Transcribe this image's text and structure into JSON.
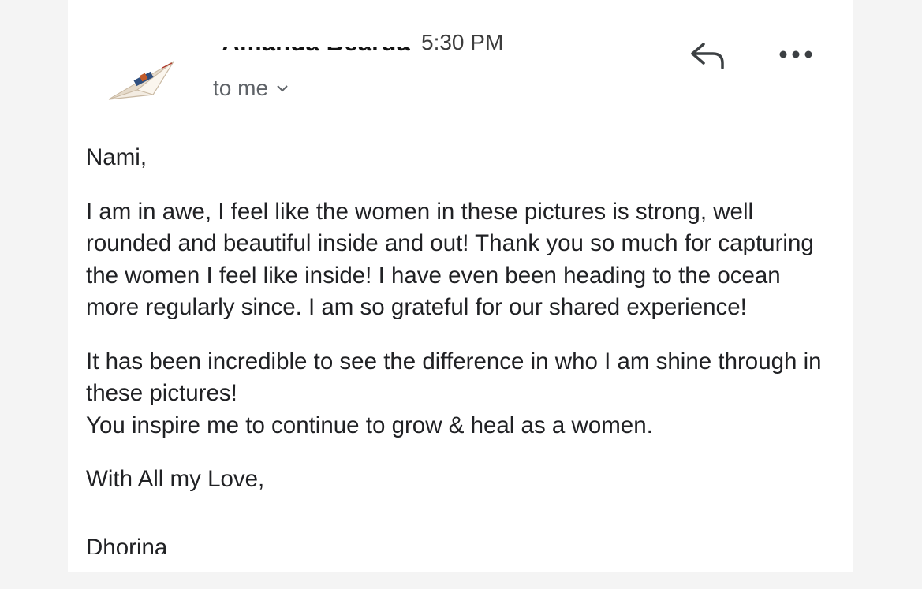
{
  "email": {
    "sender": {
      "name": "Amanda Bearda",
      "avatar_icon": "paper-airplane-icon"
    },
    "time": "5:30 PM",
    "recipient": {
      "label": "to me",
      "expand_icon": "chevron-down-icon"
    },
    "actions": {
      "reply_icon": "reply-icon",
      "more_icon": "more-options-icon"
    },
    "body": {
      "greeting": "Nami,",
      "paragraph1": "I am in awe, I feel like the women in these pictures is strong, well rounded and beautiful inside and out! Thank you so much for capturing the women I feel like inside! I have even been heading to the ocean more regularly since. I am so grateful for our shared experience!",
      "paragraph2_line1": "It has been incredible to see the difference in who I am shine through in these pictures!",
      "paragraph2_line2": "You inspire me to continue to grow & heal as a women.",
      "signoff": "With All my Love,",
      "signature": "Dhorina"
    }
  },
  "colors": {
    "page_background": "#f4f4f4",
    "card_background": "#ffffff",
    "text_primary": "#202124",
    "text_secondary": "#5f6368"
  }
}
